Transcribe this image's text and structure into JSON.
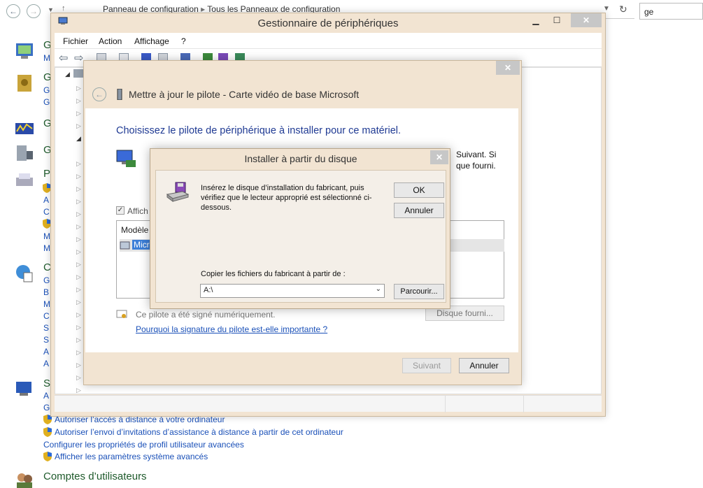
{
  "control_panel": {
    "breadcrumb": [
      "Panneau de configuration",
      "Tous les Panneaux de configuration"
    ],
    "search_value": "ge",
    "left_letters": [
      {
        "top": "G",
        "sub": [
          "M"
        ]
      },
      {
        "top": "G",
        "sub": [
          "G",
          "G"
        ]
      },
      {
        "top": "G",
        "sub": []
      },
      {
        "top": "G",
        "sub": []
      },
      {
        "top": "P",
        "sub": [
          "A",
          "C",
          "M",
          "M"
        ]
      },
      {
        "top": "C",
        "sub": [
          "G",
          "B",
          "M",
          "C",
          "S",
          "S",
          "A",
          "A"
        ]
      },
      {
        "top": "S",
        "sub": [
          "A",
          "G"
        ]
      }
    ],
    "system_links": [
      "Autoriser l’accès à distance à votre ordinateur",
      "Autoriser l’envoi d’invitations d’assistance à distance à partir de cet ordinateur",
      "Configurer les propriétés de profil utilisateur avancées",
      "Afficher les paramètres système avancés"
    ],
    "users_heading": "Comptes d’utilisateurs"
  },
  "device_manager": {
    "title": "Gestionnaire de périphériques",
    "menu": [
      "Fichier",
      "Action",
      "Affichage",
      "?"
    ]
  },
  "wizard": {
    "title": "Mettre à jour le pilote - Carte vidéo de base Microsoft",
    "heading": "Choisissez le pilote de périphérique à installer pour ce matériel.",
    "desc_line1": "Suivant. Si",
    "desc_line2": "que fourni.",
    "checkbox_label": "Affich",
    "list_header": "Modèle",
    "list_item": "Micr",
    "signed_text": "Ce pilote a été signé numériquement.",
    "why_link": "Pourquoi la signature du pilote est-elle importante ?",
    "disk_button": "Disque fourni...",
    "next_button": "Suivant",
    "cancel_button": "Annuler"
  },
  "disk_dialog": {
    "title": "Installer à partir du disque",
    "message": "Insérez le disque d’installation du fabricant, puis vérifiez que le lecteur approprié est sélectionné ci-dessous.",
    "ok_button": "OK",
    "cancel_button": "Annuler",
    "copy_label": "Copier les fichiers du fabricant à partir de :",
    "path_value": "A:\\",
    "browse_button": "Parcourir..."
  }
}
